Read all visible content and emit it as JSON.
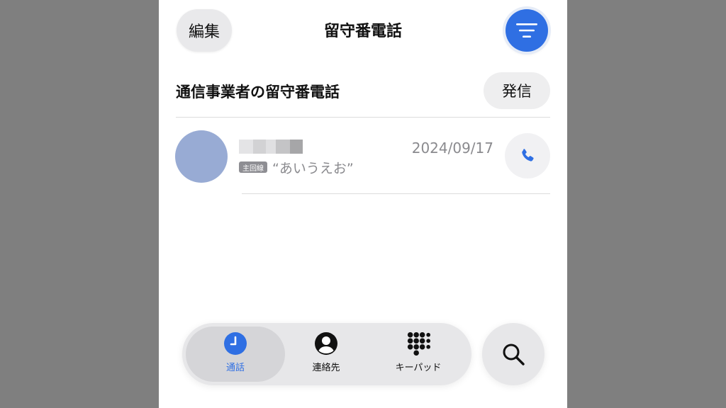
{
  "header": {
    "edit_label": "編集",
    "title": "留守番電話"
  },
  "section": {
    "title": "通信事業者の留守番電話",
    "call_label": "発信"
  },
  "voicemails": [
    {
      "date": "2024/09/17",
      "line_badge": "主回線",
      "preview": "“あいうえお”"
    }
  ],
  "tabbar": {
    "tabs": [
      {
        "label": "通話",
        "icon": "clock-icon",
        "active": true
      },
      {
        "label": "連絡先",
        "icon": "person-circle-icon",
        "active": false
      },
      {
        "label": "キーパッド",
        "icon": "keypad-icon",
        "active": false
      }
    ]
  },
  "colors": {
    "accent": "#2f6fe3",
    "avatar": "#98abd4",
    "secondary_text": "#8a8a8e"
  }
}
